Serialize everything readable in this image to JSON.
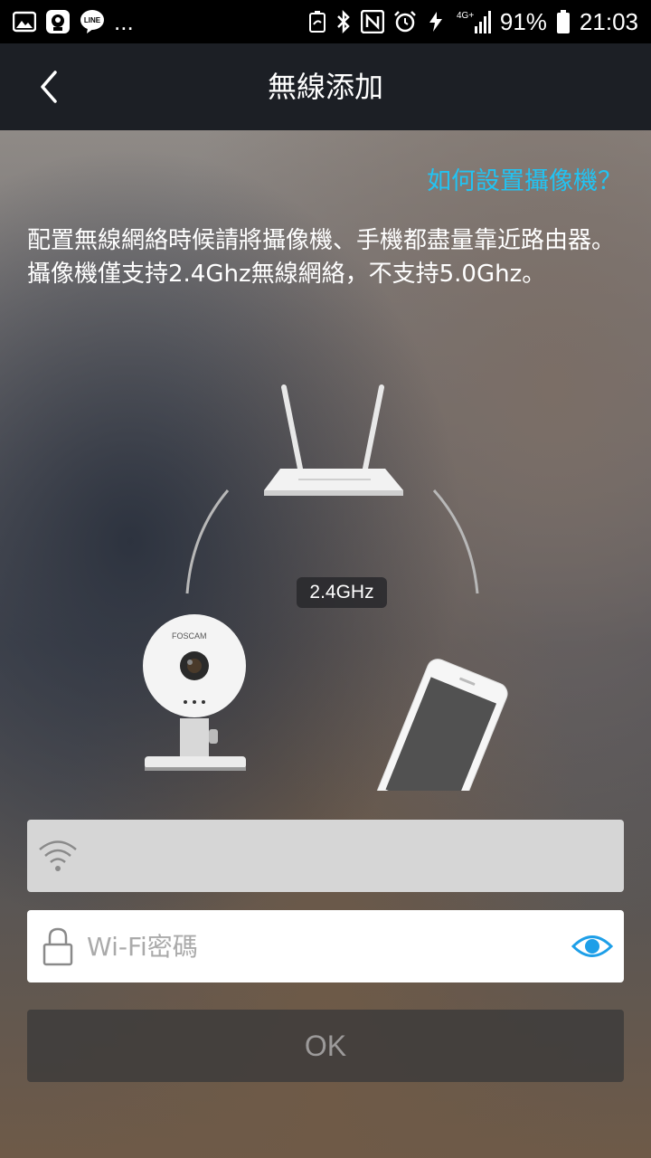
{
  "status_bar": {
    "battery": "91%",
    "time": "21:03",
    "network": "4G+",
    "more": "...",
    "icons_left": [
      "gallery-icon",
      "messenger-icon",
      "line-icon"
    ],
    "icons_right": [
      "battery-saver-icon",
      "bluetooth-icon",
      "nfc-icon",
      "alarm-icon",
      "data-icon",
      "signal-icon",
      "battery-icon"
    ]
  },
  "header": {
    "title": "無線添加",
    "back_icon": "chevron-left-icon"
  },
  "main": {
    "help_link": "如何設置攝像機？",
    "description": [
      "配置無線網絡時候請將攝像機、手機都盡量靠近路由器。",
      "攝像機僅支持2.4Ghz無線網絡，不支持5.0Ghz。"
    ],
    "illustration": {
      "frequency": "2.4GHz",
      "camera_brand": "FOSCAM"
    },
    "ssid_field": {
      "icon": "wifi-icon",
      "value": "",
      "placeholder": ""
    },
    "password_field": {
      "icon": "lock-icon",
      "value": "",
      "placeholder": "Wi-Fi密碼",
      "toggle_icon": "eye-icon"
    },
    "ok_button": "OK"
  },
  "colors": {
    "accent": "#22c3f2",
    "header_bg": "#1c1f25",
    "eye_icon": "#1e9fe8"
  }
}
